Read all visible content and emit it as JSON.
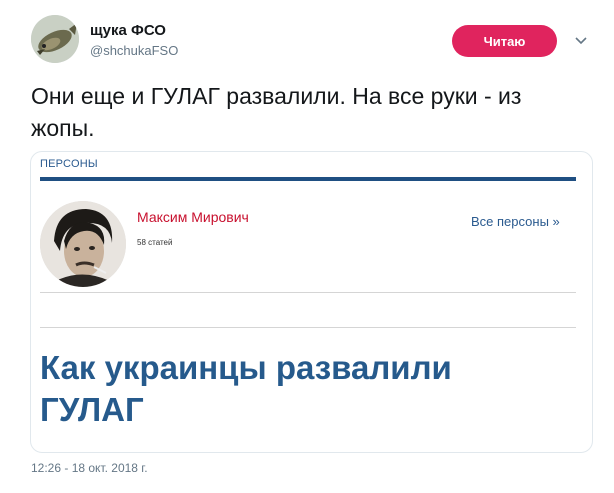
{
  "author": {
    "display_name": "щука ФСО",
    "handle": "@shchukaFSO"
  },
  "follow_button": {
    "label": "Читаю",
    "color": "#e0245e"
  },
  "icons": {
    "menu": "chevron-down-icon"
  },
  "tweet": {
    "text": "Они еще и ГУЛАГ развалили. На все руки - из жопы.",
    "timestamp": "12:26 - 18 окт. 2018 г."
  },
  "card": {
    "section_label": "ПЕРСОНЫ",
    "person": {
      "name": "Максим Мирович",
      "article_count": "58 статей"
    },
    "all_persons_link": "Все персоны »",
    "headline": "Как украинцы развалили ГУЛАГ"
  },
  "colors": {
    "name_red": "#c8102e",
    "link_blue": "#2a5a8f",
    "headline_blue": "#265a8c",
    "rule_blue": "#1f4f82"
  }
}
